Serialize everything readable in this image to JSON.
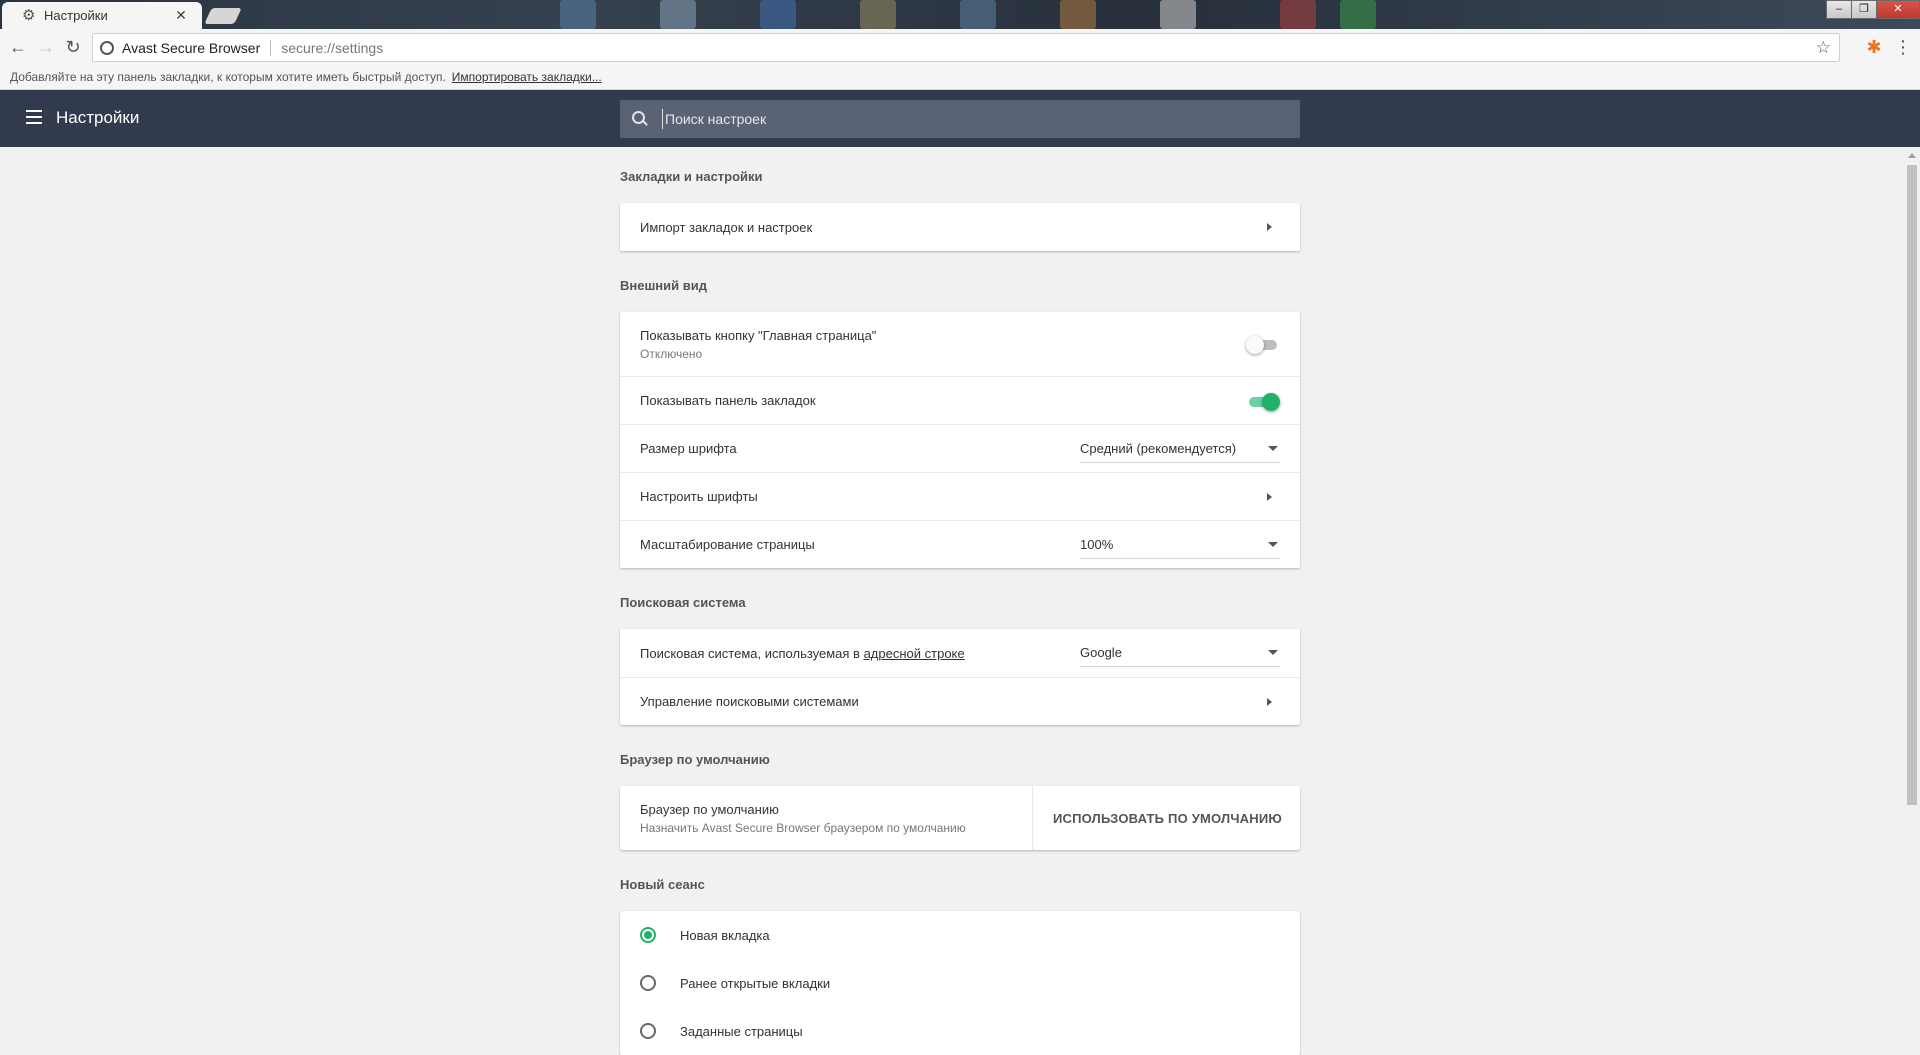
{
  "tab": {
    "title": "Настройки",
    "close": "✕"
  },
  "toolbar": {
    "site": "Avast Secure Browser",
    "url": "secure://settings"
  },
  "bookmarks_bar": {
    "hint": "Добавляйте на эту панель закладки, к которым хотите иметь быстрый доступ.",
    "import_link": "Импортировать закладки..."
  },
  "header": {
    "title": "Настройки",
    "search_placeholder": "Поиск настроек"
  },
  "sections": {
    "bookmarks": {
      "title": "Закладки и настройки",
      "import_row": "Импорт закладок и настроек"
    },
    "appearance": {
      "title": "Внешний вид",
      "home_button": {
        "label": "Показывать кнопку \"Главная страница\"",
        "status": "Отключено",
        "enabled": false
      },
      "bookmarks_bar": {
        "label": "Показывать панель закладок",
        "enabled": true
      },
      "font_size": {
        "label": "Размер шрифта",
        "value": "Средний (рекомендуется)"
      },
      "customize_fonts": {
        "label": "Настроить шрифты"
      },
      "page_zoom": {
        "label": "Масштабирование страницы",
        "value": "100%"
      }
    },
    "search": {
      "title": "Поисковая система",
      "engine": {
        "label_before": "Поисковая система, используемая в ",
        "label_link": "адресной строке",
        "value": "Google"
      },
      "manage": {
        "label": "Управление поисковыми системами"
      }
    },
    "default_browser": {
      "title": "Браузер по умолчанию",
      "label": "Браузер по умолчанию",
      "sub": "Назначить Avast Secure Browser браузером по умолчанию",
      "button": "ИСПОЛЬЗОВАТЬ ПО УМОЛЧАНИЮ"
    },
    "startup": {
      "title": "Новый сеанс",
      "options": [
        {
          "label": "Новая вкладка",
          "checked": true
        },
        {
          "label": "Ранее открытые вкладки",
          "checked": false
        },
        {
          "label": "Заданные страницы",
          "checked": false
        }
      ]
    }
  },
  "colors": {
    "header_bg": "#323a4d",
    "accent": "#21b26a",
    "avast_orange": "#f37021"
  }
}
